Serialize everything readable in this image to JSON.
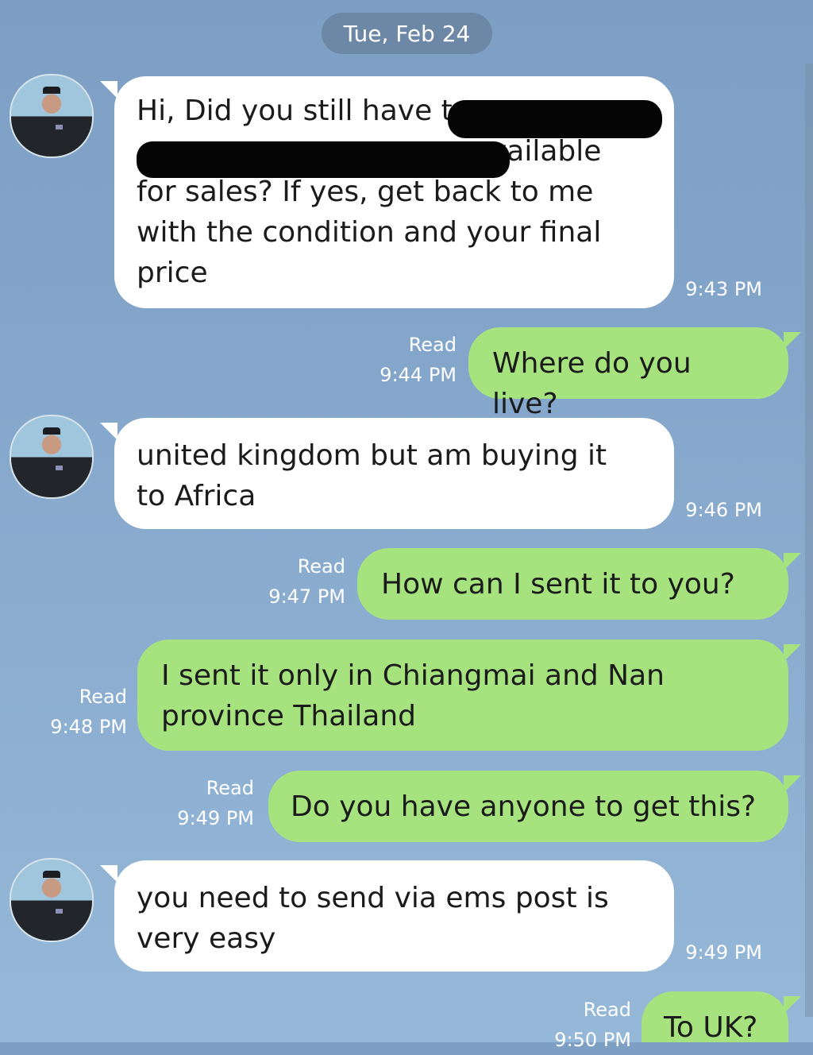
{
  "chat": {
    "date": "Tue, Feb 24",
    "messages": [
      {
        "from": "contact",
        "lines": [
          "Hi, Did you still have t",
          "vailable",
          "for sales? If yes, get back to me",
          "with  the condition and  your final",
          "price"
        ],
        "time": "9:43 PM"
      },
      {
        "from": "me",
        "text": "Where do you live?",
        "status": "Read",
        "time": "9:44 PM"
      },
      {
        "from": "contact",
        "lines": [
          "united kingdom but am buying it",
          "to Africa"
        ],
        "time": "9:46 PM"
      },
      {
        "from": "me",
        "text": "How can I sent it to you?",
        "status": "Read",
        "time": "9:47 PM"
      },
      {
        "from": "me",
        "lines": [
          "I sent  it only in Chiangmai and  Nan",
          "province Thailand"
        ],
        "status": "Read",
        "time": "9:48 PM"
      },
      {
        "from": "me",
        "text": "Do you have anyone to get this?",
        "status": "Read",
        "time": "9:49 PM"
      },
      {
        "from": "contact",
        "lines": [
          "you need to send via ems post is",
          "very easy"
        ],
        "time": "9:49 PM"
      },
      {
        "from": "me",
        "text": "To UK?",
        "status": "Read",
        "time": "9:50 PM"
      }
    ]
  },
  "colors": {
    "incoming": "#ffffff",
    "outgoing": "#a6e37f",
    "background": "#84a6ca"
  },
  "icons": {
    "avatar": "contact-avatar-icon"
  }
}
